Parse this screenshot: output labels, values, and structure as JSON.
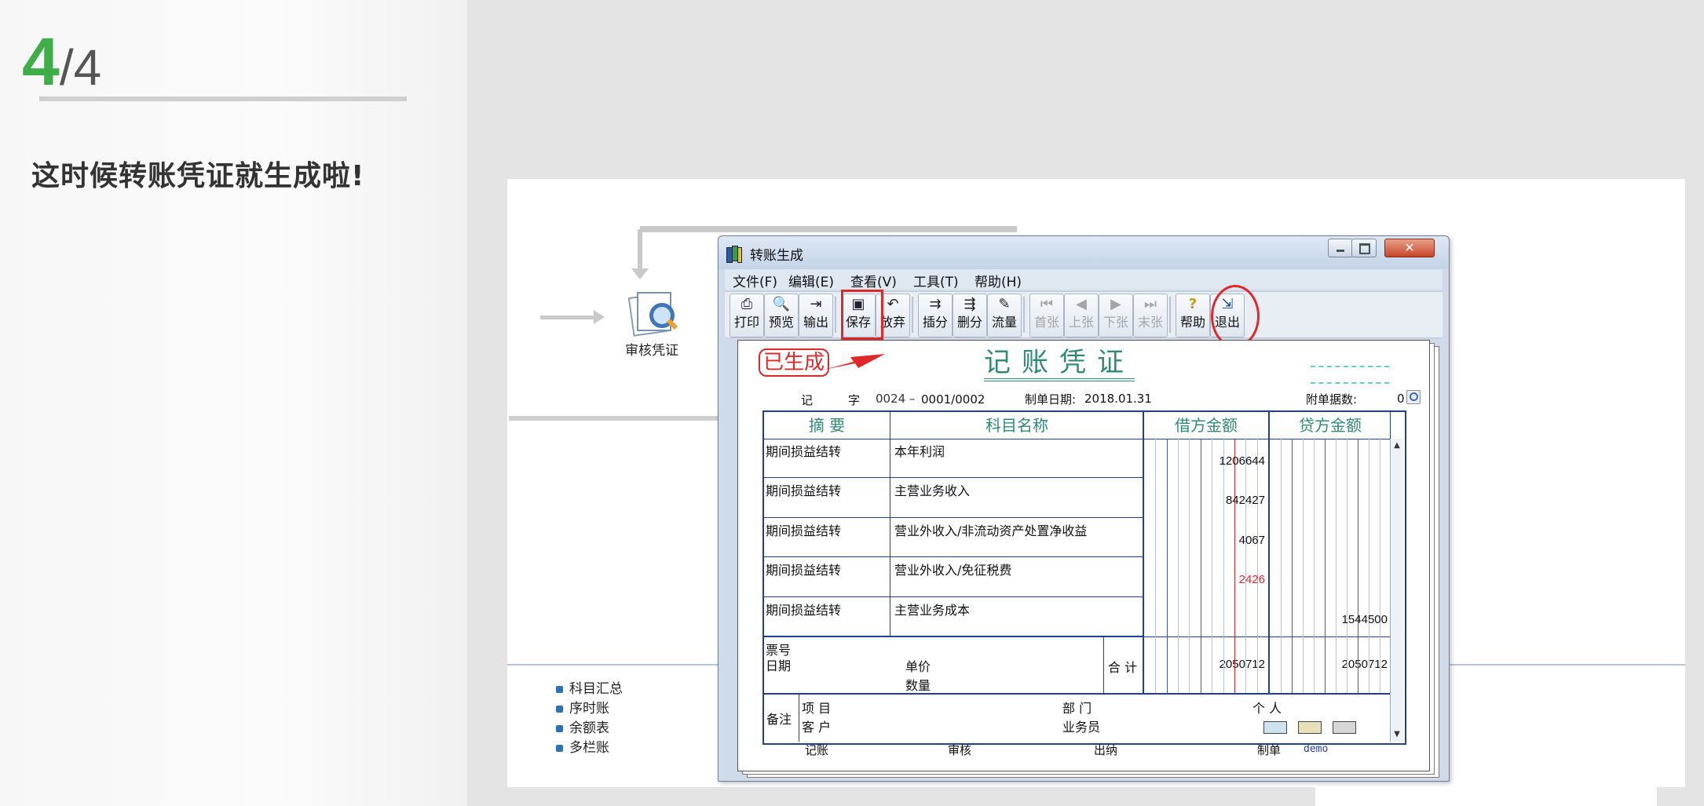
{
  "slide": {
    "current": "4",
    "total": "/4",
    "heading": "这时候转账凭证就生成啦!"
  },
  "flow": {
    "audit_label": "审核凭证"
  },
  "bottom_menu": [
    "科目汇总",
    "序时账",
    "余额表",
    "多栏账"
  ],
  "window": {
    "title": "转账生成",
    "menu": [
      "文件(F)",
      "编辑(E)",
      "查看(V)",
      "工具(T)",
      "帮助(H)"
    ],
    "toolbar": {
      "print": "打印",
      "preview": "预览",
      "export": "输出",
      "save": "保存",
      "discard": "放弃",
      "insert_entry": "插分",
      "delete_entry": "删分",
      "cash_flow": "流量",
      "first": "首张",
      "prev": "上张",
      "next": "下张",
      "last": "末张",
      "help": "帮助",
      "exit": "退出"
    }
  },
  "voucher": {
    "stamp": "已生成",
    "title": "记账凭证",
    "type_char": "记",
    "word": "字",
    "number_prefix": "0024 –",
    "number": "0001/0002",
    "date_label": "制单日期:",
    "date": "2018.01.31",
    "attachments_label": "附单据数:",
    "attachments": "0",
    "headers": {
      "summary": "摘 要",
      "account": "科目名称",
      "debit": "借方金额",
      "credit": "贷方金额"
    },
    "rows": [
      {
        "summary": "期间损益结转",
        "account": "本年利润",
        "debit": "1206644",
        "credit": "",
        "debit_red": false
      },
      {
        "summary": "期间损益结转",
        "account": "主营业务收入",
        "debit": "842427",
        "credit": "",
        "debit_red": false
      },
      {
        "summary": "期间损益结转",
        "account": "营业外收入/非流动资产处置净收益",
        "debit": "4067",
        "credit": "",
        "debit_red": false
      },
      {
        "summary": "期间损益结转",
        "account": "营业外收入/免征税费",
        "debit": "2426",
        "credit": "",
        "debit_red": true
      },
      {
        "summary": "期间损益结转",
        "account": "主营业务成本",
        "debit": "",
        "credit": "1544500",
        "debit_red": false
      }
    ],
    "footer": {
      "ticket_no": "票号",
      "date": "日期",
      "unit_price": "单价",
      "quantity": "数量",
      "total_label": "合 计",
      "total_debit": "2050712",
      "total_credit": "2050712"
    },
    "notes": {
      "remark": "备注",
      "project": "项 目",
      "customer": "客 户",
      "department": "部 门",
      "salesperson": "业务员",
      "person": "个 人"
    },
    "signatures": {
      "bookkeeping": "记账",
      "audit": "审核",
      "cashier": "出纳",
      "preparer": "制单",
      "preparer_name": "demo"
    }
  },
  "colors": {
    "accent_green": "#3fae49",
    "voucher_title": "#2f8a7a",
    "grid_blue": "#1f3f9a",
    "highlight_red": "#e0282a"
  }
}
